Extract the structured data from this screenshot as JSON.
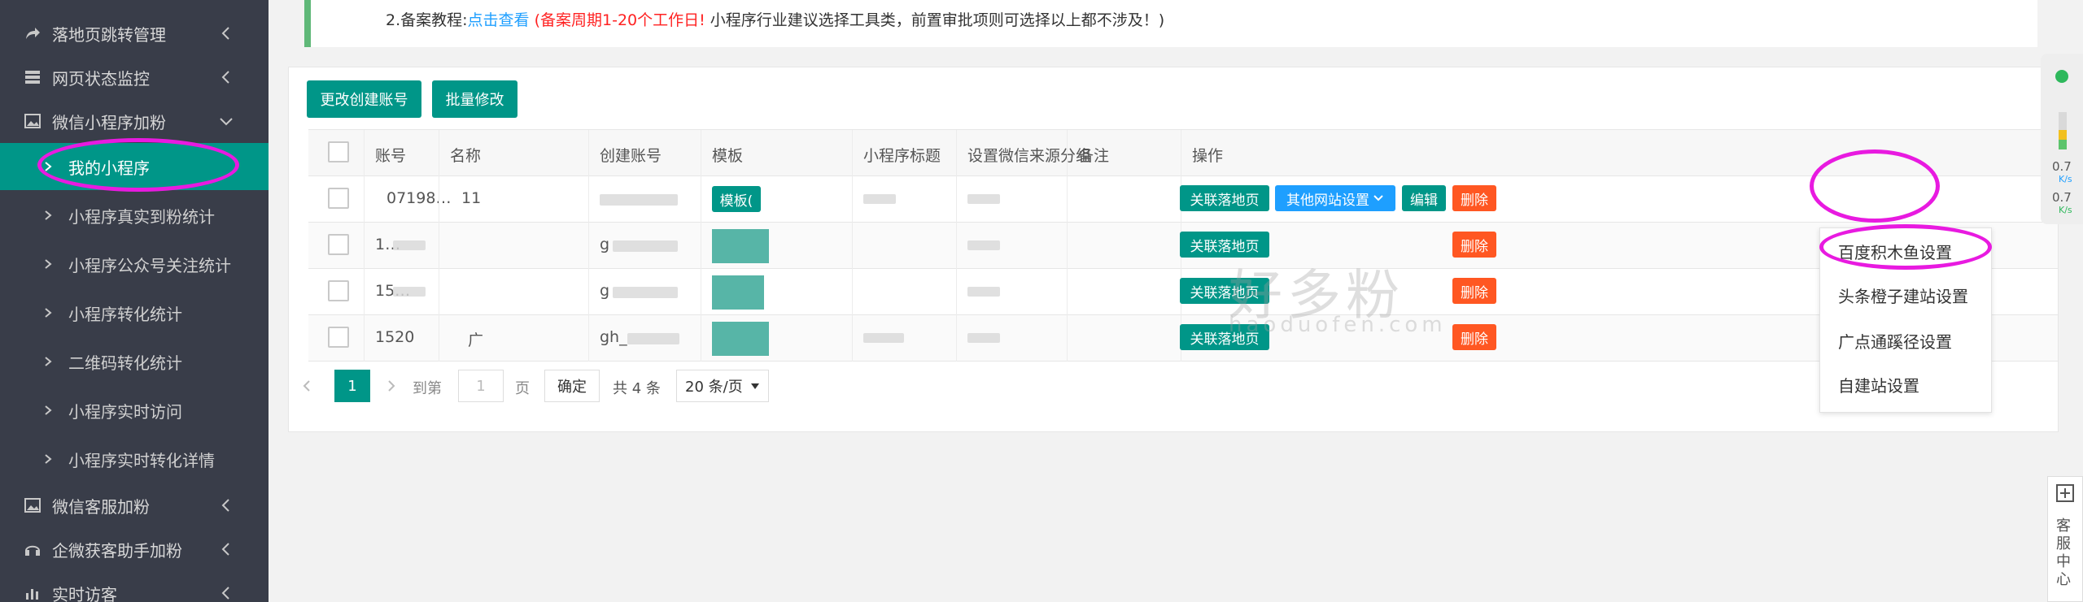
{
  "sidebar": {
    "top_items": [
      {
        "label": "落地页跳转管理",
        "icon": "share-icon"
      },
      {
        "label": "网页状态监控",
        "icon": "server-icon"
      },
      {
        "label": "微信小程序加粉",
        "icon": "image-icon"
      }
    ],
    "sub_items": [
      {
        "label": "我的小程序"
      },
      {
        "label": "小程序真实到粉统计"
      },
      {
        "label": "小程序公众号关注统计"
      },
      {
        "label": "小程序转化统计"
      },
      {
        "label": "二维码转化统计"
      },
      {
        "label": "小程序实时访问"
      },
      {
        "label": "小程序实时转化详情"
      }
    ],
    "bottom_items": [
      {
        "label": "微信客服加粉",
        "icon": "image-icon"
      },
      {
        "label": "企微获客助手加粉",
        "icon": "headset-icon"
      },
      {
        "label": "实时访客",
        "icon": "bar-chart-icon"
      }
    ]
  },
  "notice": {
    "line2_prefix": "2.备案教程:",
    "line2_link": "点击查看",
    "line2_red": "(备案周期1-20个工作日!",
    "line2_rest": " 小程序行业建议选择工具类，前置审批项则可选择以上都不涉及！)"
  },
  "toolbar": {
    "change_account": "更改创建账号",
    "batch_edit": "批量修改"
  },
  "table": {
    "headers": [
      "账号",
      "名称",
      "创建账号",
      "模板",
      "小程序标题",
      "设置微信来源分组",
      "备注",
      "操作"
    ],
    "rows": [
      {
        "account": "07198…",
        "name": "11",
        "template": "模板("
      },
      {
        "account": "1…",
        "name": "",
        "template": ""
      },
      {
        "account": "15…",
        "name": "",
        "template": ""
      },
      {
        "account": "1520",
        "name": "广",
        "template": ""
      }
    ],
    "row_prefix_creator": [
      "",
      "g",
      "g",
      "gh_"
    ],
    "actions": {
      "link_landing": "关联落地页",
      "other_settings": "其他网站设置",
      "edit": "编辑",
      "delete": "删除"
    }
  },
  "pagination": {
    "current_page": "1",
    "goto_label": "到第",
    "page_input": "1",
    "page_unit": "页",
    "confirm": "确定",
    "total": "共 4 条",
    "page_size": "20 条/页"
  },
  "dropdown": {
    "items": [
      "百度积木鱼设置",
      "头条橙子建站设置",
      "广点通蹊径设置",
      "自建站设置"
    ]
  },
  "watermark": {
    "text": "好多粉",
    "subtext": "haoduofen.com"
  },
  "speed_widget": {
    "up_value": "0.7",
    "up_unit": "K/s",
    "down_value": "0.7",
    "down_unit": "K/s"
  },
  "service_widget": {
    "label": "客服中心"
  },
  "colors": {
    "sidebar_bg": "#393d49",
    "accent": "#009688",
    "danger": "#ff5722",
    "info": "#1e9fff",
    "annotation": "#e81ae0"
  }
}
